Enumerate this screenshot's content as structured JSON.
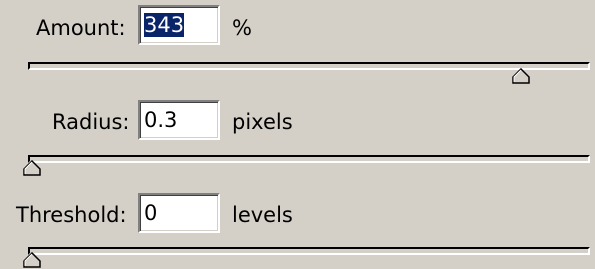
{
  "amount": {
    "label": "Amount:",
    "value": "343",
    "unit": "%",
    "slider_position": 0.9
  },
  "radius": {
    "label": "Radius:",
    "value": "0.3",
    "unit": "pixels",
    "slider_position": 0.0
  },
  "threshold": {
    "label": "Threshold:",
    "value": "0",
    "unit": "levels",
    "slider_position": 0.0
  },
  "colors": {
    "background": "#d4d0c8",
    "selection": "#0a246a"
  },
  "icons": {
    "slider_thumb": "triangle-slider-thumb-icon"
  }
}
